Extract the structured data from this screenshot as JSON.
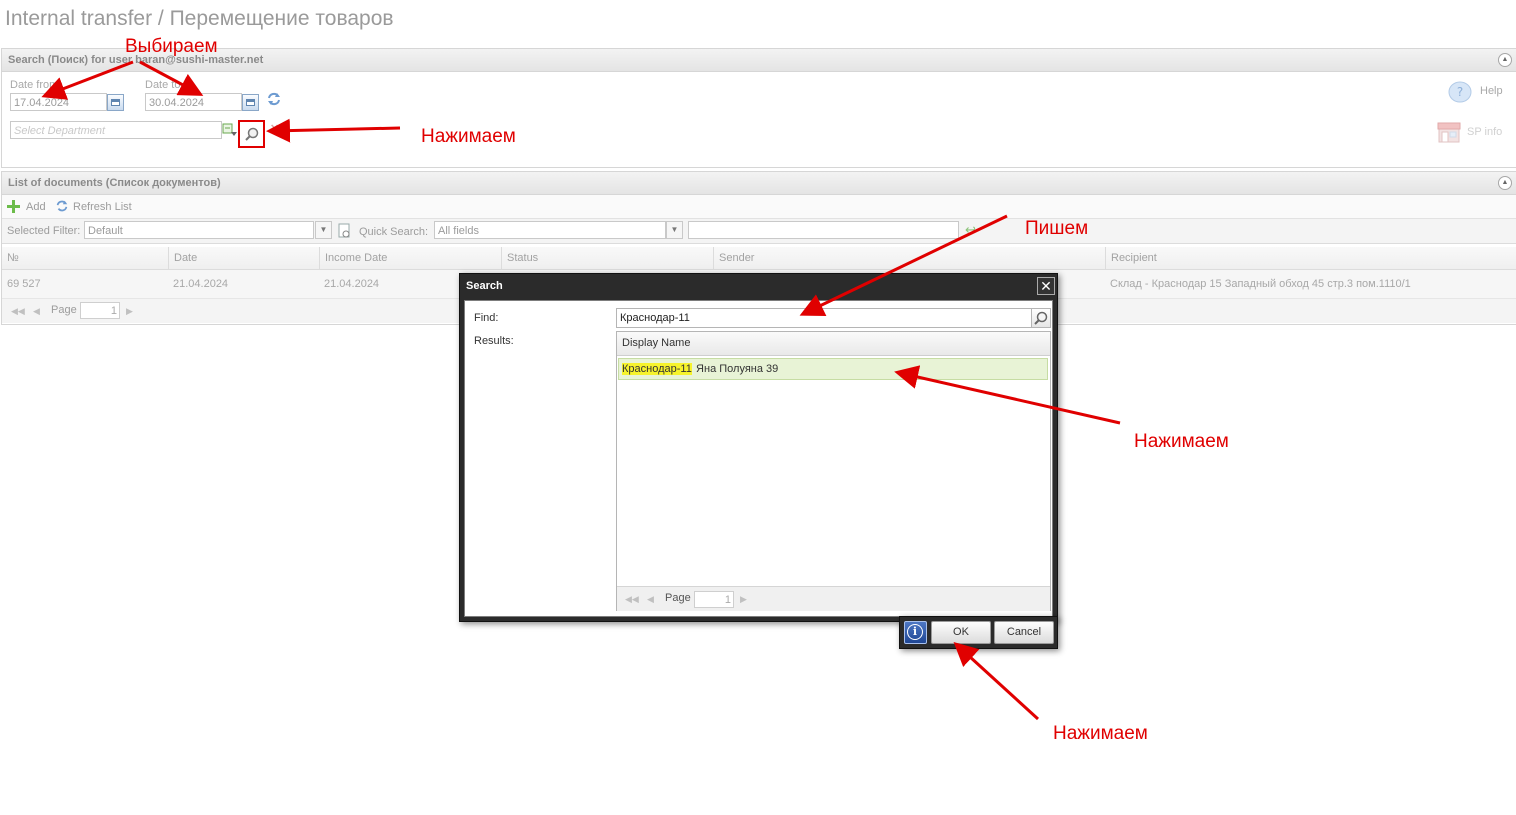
{
  "page": {
    "title": "Internal transfer / Перемещение товаров"
  },
  "search_panel": {
    "header": "Search (Поиск) for user baran@sushi-master.net",
    "date_from_label": "Date from",
    "date_from_value": "17.04.2024",
    "date_to_label": "Date to",
    "date_to_value": "30.04.2024",
    "department_placeholder": "Select Department",
    "help_label": "Help",
    "sp_info_label": "SP info"
  },
  "documents_panel": {
    "header": "List of documents (Список документов)",
    "add_label": "Add",
    "refresh_label": "Refresh List",
    "selected_filter_label": "Selected Filter:",
    "selected_filter_value": "Default",
    "quick_search_label": "Quick Search:",
    "quick_search_field": "All fields",
    "columns": [
      "№",
      "Date",
      "Income Date",
      "Status",
      "Sender",
      "Recipient"
    ],
    "rows": [
      {
        "number": "69 527",
        "date": "21.04.2024",
        "income_date": "21.04.2024",
        "recipient": "Склад - Краснодар 15 Западный обход 45 стр.3 пом.1110/1"
      }
    ],
    "page_label": "Page",
    "page_value": "1"
  },
  "dialog": {
    "title": "Search",
    "close_glyph": "✕",
    "find_label": "Find:",
    "find_value": "Краснодар-11",
    "results_label": "Results:",
    "results_header": "Display Name",
    "result_highlight": "Краснодар-11",
    "result_rest": " Яна Полуяна 39",
    "page_label": "Page",
    "page_value": "1",
    "info_glyph": "i",
    "ok_label": "OK",
    "cancel_label": "Cancel"
  },
  "annotations": {
    "choose": "Выбираем",
    "click1": "Нажимаем",
    "write": "Пишем",
    "click2": "Нажимаем",
    "click3": "Нажимаем",
    "color": "#e00000"
  }
}
